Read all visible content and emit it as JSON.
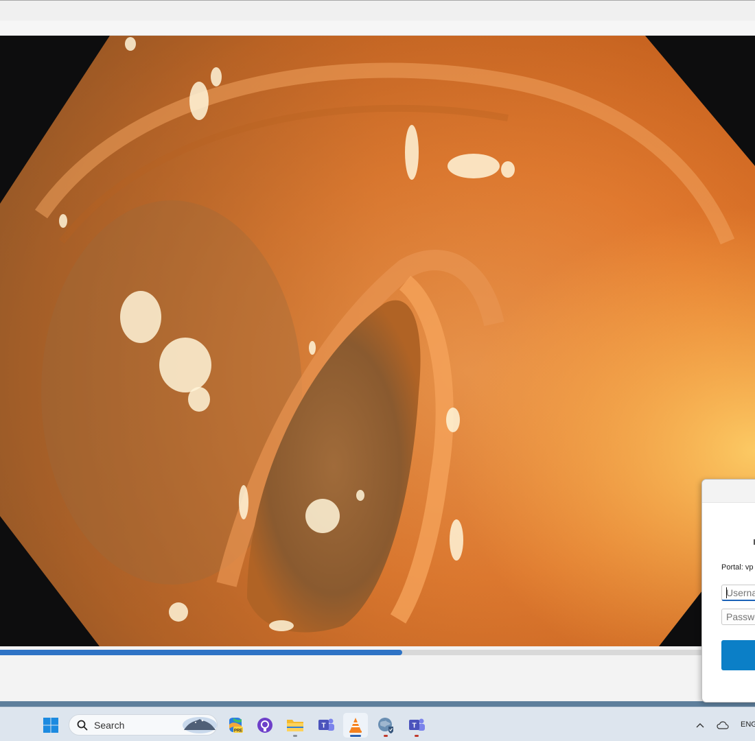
{
  "window": {
    "title": ""
  },
  "video": {
    "progress_fraction": 0.533
  },
  "dialog": {
    "portal_label": "Portal: vp",
    "username_placeholder": "Userna",
    "password_placeholder": "Passwo",
    "connect_label": ""
  },
  "taskbar": {
    "search_label": "Search",
    "apps": [
      "start-icon",
      "copilot-icon",
      "github-icon",
      "file-explorer-icon",
      "teams-icon",
      "vlc-icon",
      "vpn-globe-icon",
      "teams-icon"
    ],
    "language": "ENG"
  },
  "colors": {
    "accent": "#2e73c5",
    "connect_button": "#0b7fc7",
    "tissue": "#e07a2e"
  }
}
